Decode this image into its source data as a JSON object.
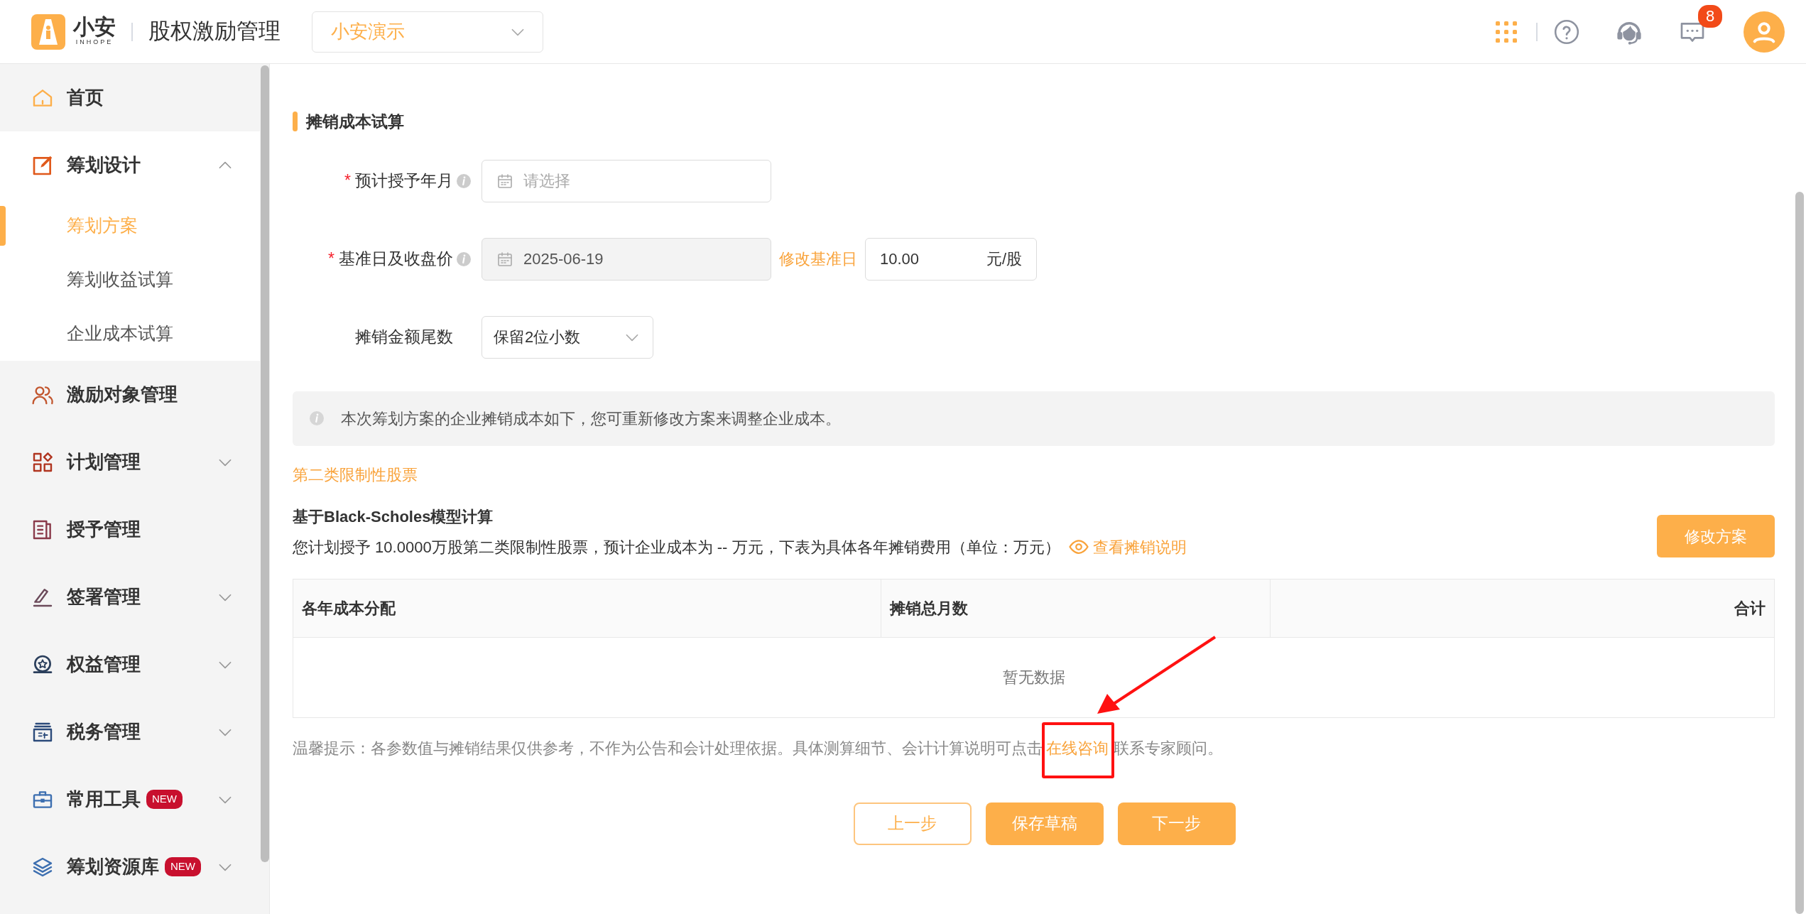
{
  "header": {
    "logo_text": "小安",
    "logo_subtext": "INHOPE",
    "app_title": "股权激励管理",
    "org_select": {
      "value": "小安演示"
    },
    "notification_count": "8"
  },
  "sidebar": {
    "items": [
      {
        "label": "首页",
        "selected": false
      },
      {
        "label": "筹划设计",
        "expanded": true,
        "selected": false,
        "children": [
          {
            "label": "筹划方案",
            "selected": true
          },
          {
            "label": "筹划收益试算",
            "selected": false
          },
          {
            "label": "企业成本试算",
            "selected": false
          }
        ]
      },
      {
        "label": "激励对象管理",
        "selected": false
      },
      {
        "label": "计划管理",
        "expanded": false,
        "selected": false
      },
      {
        "label": "授予管理",
        "selected": false
      },
      {
        "label": "签署管理",
        "expanded": false,
        "selected": false
      },
      {
        "label": "权益管理",
        "expanded": false,
        "selected": false
      },
      {
        "label": "税务管理",
        "expanded": false,
        "selected": false
      },
      {
        "label": "常用工具",
        "expanded": false,
        "selected": false,
        "badge": "NEW"
      },
      {
        "label": "筹划资源库",
        "expanded": false,
        "selected": false,
        "badge": "NEW"
      }
    ]
  },
  "form": {
    "title": "摊销成本试算",
    "rows": [
      {
        "kind": "date",
        "label": "预计授予年月",
        "required_mark": "*",
        "hint_icon": true,
        "placeholder": "请选择",
        "disabled": false
      },
      {
        "kind": "date-price",
        "label": "基准日及收盘价",
        "required_mark": "*",
        "hint_icon": true,
        "value": "2025-06-19",
        "disabled": true,
        "link": "修改基准日",
        "price": "10.00",
        "unit": "元/股"
      },
      {
        "kind": "select",
        "label": "摊销金额尾数",
        "hint_icon": false,
        "value": "保留2位小数"
      }
    ]
  },
  "notice": "本次筹划方案的企业摊销成本如下，您可重新修改方案来调整企业成本。",
  "category": "第二类限制性股票",
  "model_title": "基于Black-Scholes模型计算",
  "summary": "您计划授予 10.0000万股第二类限制性股票，预计企业成本为 -- 万元，下表为具体各年摊销费用（单位：万元）",
  "summary_link": "查看摊销说明",
  "edit_button": "修改方案",
  "table": {
    "columns": [
      "各年成本分配",
      "摊销总月数",
      "合计"
    ],
    "empty_text": "暂无数据"
  },
  "tip": {
    "before": "温馨提示：各参数值与摊销结果仅供参考，不作为公告和会计处理依据。具体测算细节、会计计算说明可点击",
    "link": "在线咨询",
    "after": "联系专家顾问。"
  },
  "buttons": [
    {
      "label": "上一步",
      "kind": "outline"
    },
    {
      "label": "保存草稿",
      "kind": "primary"
    },
    {
      "label": "下一步",
      "kind": "primary"
    }
  ]
}
